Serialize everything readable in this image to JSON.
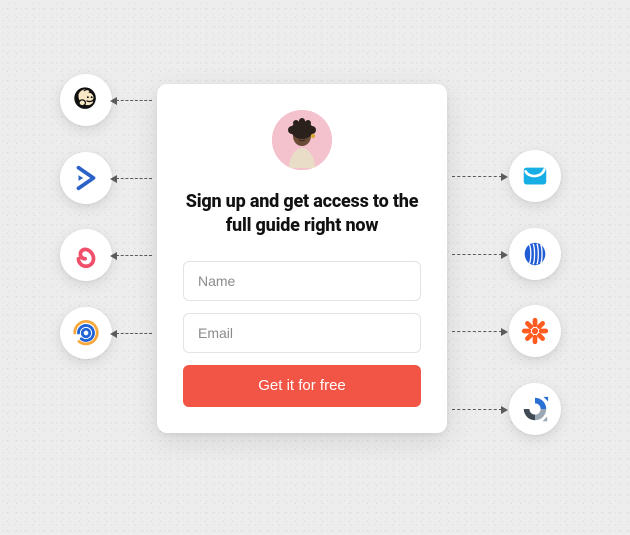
{
  "card": {
    "headline": "Sign up and get access to the full guide right now",
    "name_placeholder": "Name",
    "email_placeholder": "Email",
    "cta_label": "Get it for free"
  },
  "integrations": {
    "left": [
      {
        "id": "mailchimp",
        "label": "Mailchimp"
      },
      {
        "id": "activecampaign",
        "label": "ActiveCampaign"
      },
      {
        "id": "convertkit",
        "label": "ConvertKit"
      },
      {
        "id": "constantcontact",
        "label": "Constant Contact"
      }
    ],
    "right": [
      {
        "id": "getresponse",
        "label": "GetResponse"
      },
      {
        "id": "aweber",
        "label": "AWeber"
      },
      {
        "id": "zapier",
        "label": "Zapier"
      },
      {
        "id": "recaptcha",
        "label": "reCAPTCHA"
      }
    ]
  },
  "colors": {
    "cta": "#f25445",
    "card_bg": "#ffffff",
    "page_bg": "#ededed"
  }
}
